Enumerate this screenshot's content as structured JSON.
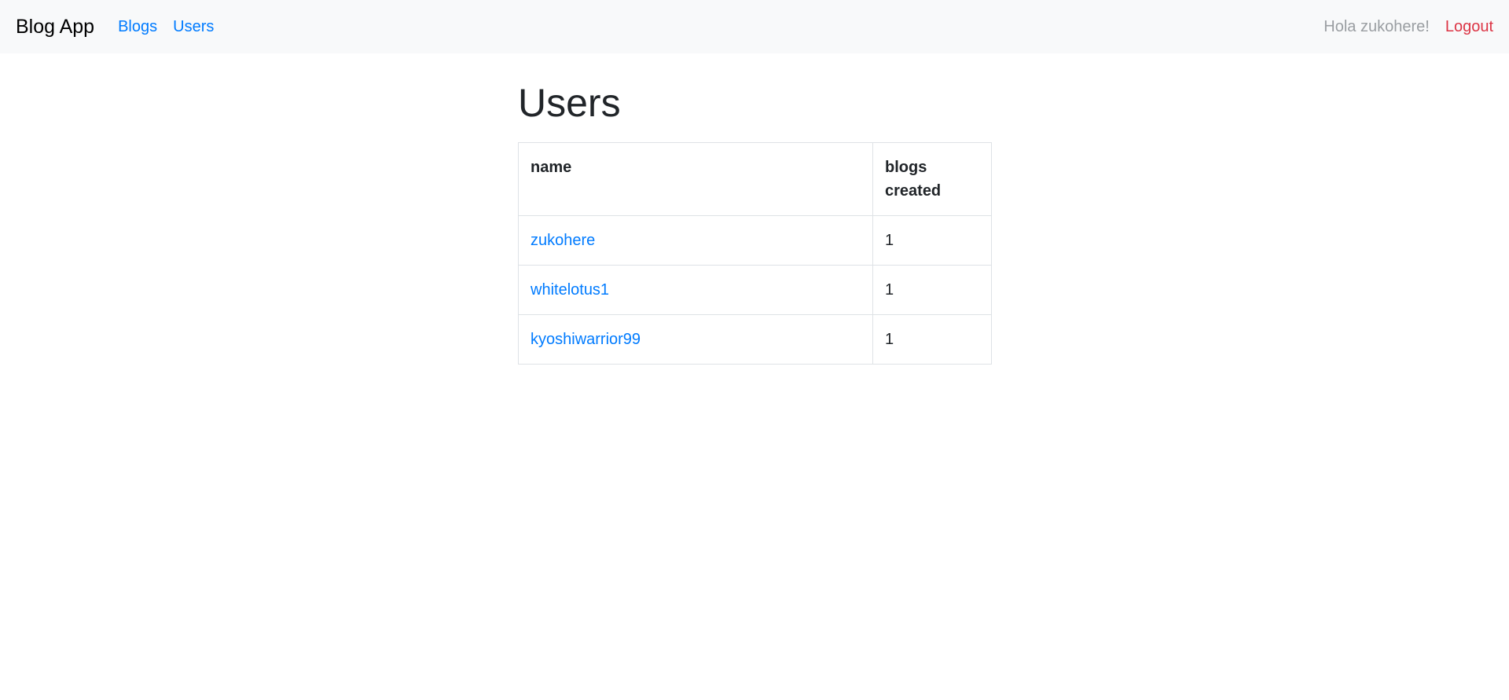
{
  "navbar": {
    "brand": "Blog App",
    "links": [
      {
        "label": "Blogs"
      },
      {
        "label": "Users"
      }
    ],
    "greeting": "Hola zukohere!",
    "logout_label": "Logout"
  },
  "main": {
    "title": "Users",
    "table": {
      "headers": [
        "name",
        "blogs created"
      ],
      "rows": [
        {
          "name": "zukohere",
          "blogs_created": "1"
        },
        {
          "name": "whitelotus1",
          "blogs_created": "1"
        },
        {
          "name": "kyoshiwarrior99",
          "blogs_created": "1"
        }
      ]
    }
  },
  "colors": {
    "navbar_bg": "#f8f9fa",
    "link": "#007bff",
    "logout": "#dc3545",
    "greeting": "#9a9ea2"
  }
}
